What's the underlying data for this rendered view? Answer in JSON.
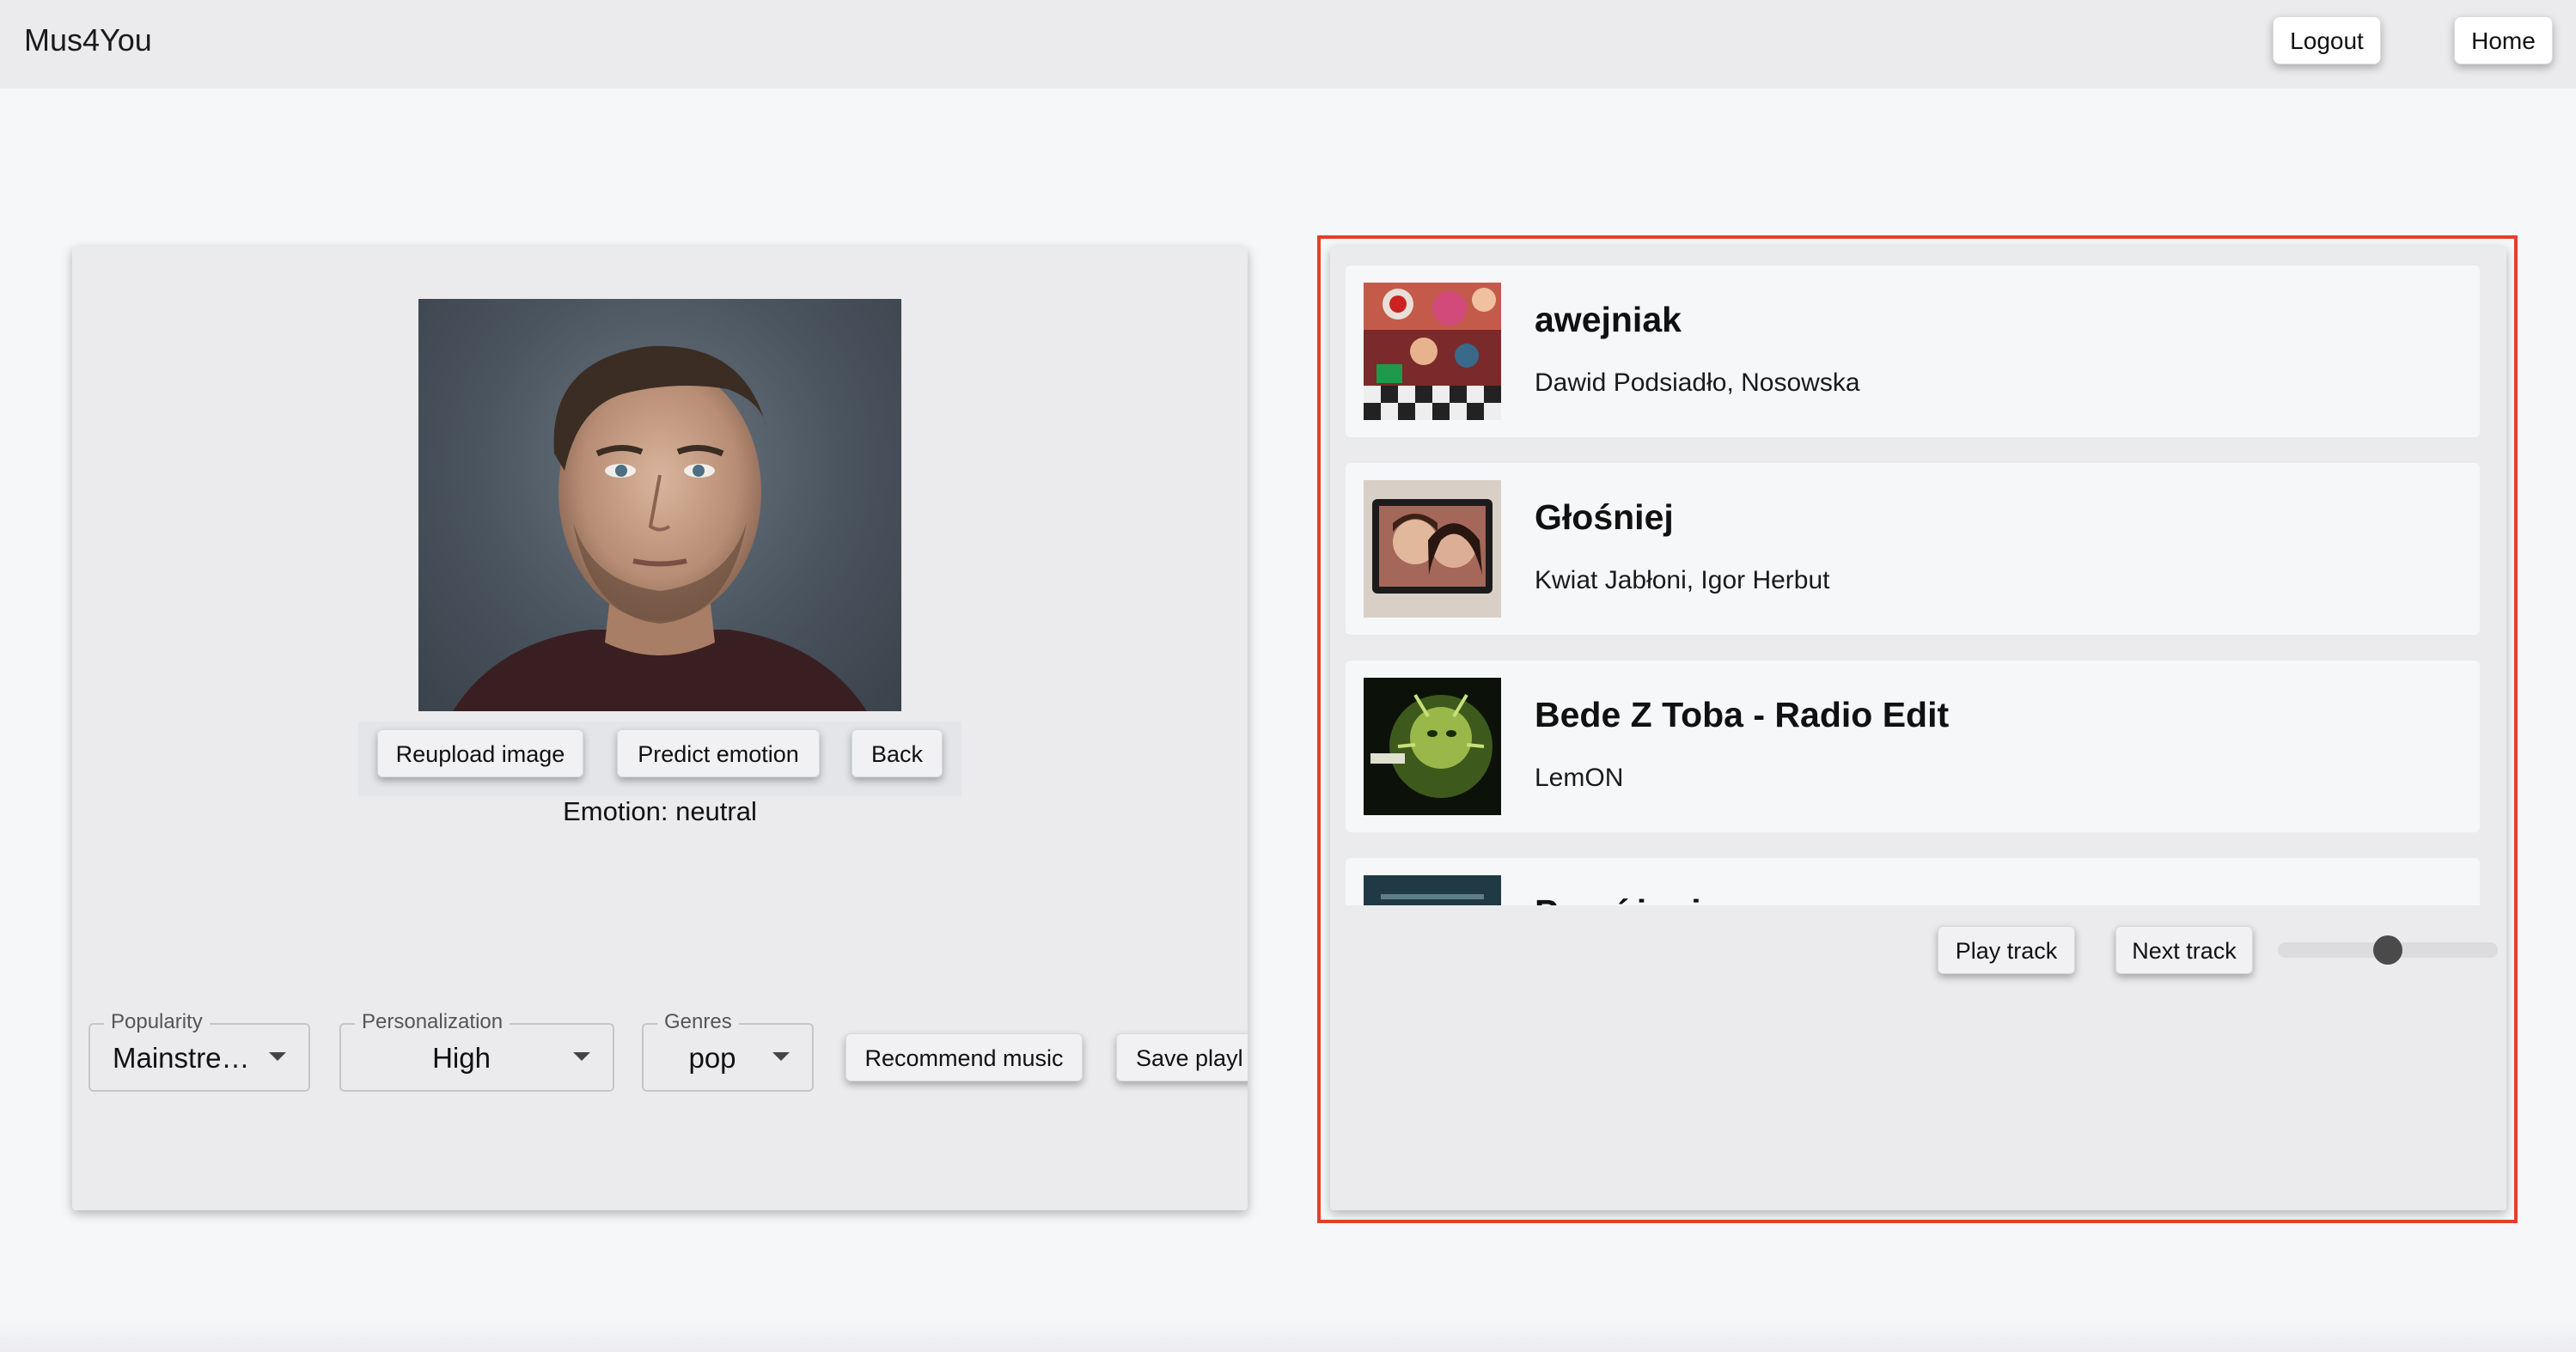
{
  "app": {
    "title": "Mus4You"
  },
  "header": {
    "logout_label": "Logout",
    "home_label": "Home"
  },
  "image_panel": {
    "reupload_label": "Reupload image",
    "predict_label": "Predict emotion",
    "back_label": "Back",
    "emotion_text": "Emotion: neutral"
  },
  "filters": {
    "popularity": {
      "label": "Popularity",
      "value": "Mainstre…"
    },
    "personalization": {
      "label": "Personalization",
      "value": "High"
    },
    "genres": {
      "label": "Genres",
      "value": "pop"
    },
    "recommend_label": "Recommend music",
    "save_label": "Save playl"
  },
  "tracks": [
    {
      "title": "awejniak",
      "artist": "Dawid Podsiadło, Nosowska",
      "cover_icon": "album-cover-collage"
    },
    {
      "title": "Głośniej",
      "artist": "Kwiat Jabłoni, Igor Herbut",
      "cover_icon": "album-cover-duo"
    },
    {
      "title": "Bede Z Toba - Radio Edit",
      "artist": "LemON",
      "cover_icon": "album-cover-green"
    },
    {
      "title": "Pomóż mi",
      "artist": "",
      "cover_icon": "album-cover-dark"
    }
  ],
  "player": {
    "play_label": "Play track",
    "next_label": "Next track",
    "volume_fraction": 0.5
  },
  "colors": {
    "highlight": "#e2402a",
    "panel": "#ebebed",
    "background": "#f6f7f9"
  }
}
